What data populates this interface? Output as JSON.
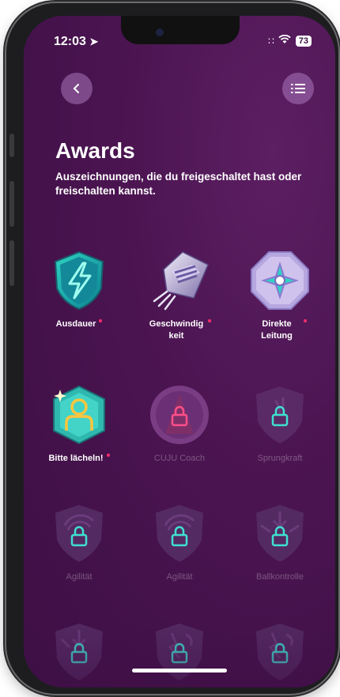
{
  "status": {
    "time": "12:03",
    "battery": "73"
  },
  "nav": {
    "back_icon": "chevron-left-icon",
    "menu_icon": "list-icon"
  },
  "header": {
    "title": "Awards",
    "subtitle": "Auszeichnungen, die du freigeschaltet hast oder freischalten kannst."
  },
  "colors": {
    "background": "#4a1450",
    "accent_dot": "#ff2d6e",
    "teal": "#3fe0d0"
  },
  "awards": [
    {
      "label": "Ausdauer",
      "unlocked": true,
      "new": true,
      "icon": "lightning-shield-icon"
    },
    {
      "label": "Geschwindig keit",
      "unlocked": true,
      "new": true,
      "icon": "speed-crystal-icon"
    },
    {
      "label": "Direkte Leitung",
      "unlocked": true,
      "new": true,
      "icon": "compass-octagon-icon"
    },
    {
      "label": "Bitte lächeln!",
      "unlocked": true,
      "new": true,
      "icon": "person-hexagon-icon"
    },
    {
      "label": "CUJU Coach",
      "unlocked": false,
      "new": false,
      "icon": "cone-lock-icon"
    },
    {
      "label": "Sprungkraft",
      "unlocked": false,
      "new": false,
      "icon": "shield-lock-icon"
    },
    {
      "label": "Agilität",
      "unlocked": false,
      "new": false,
      "icon": "shield-lock-icon"
    },
    {
      "label": "Agilität",
      "unlocked": false,
      "new": false,
      "icon": "shield-lock-icon"
    },
    {
      "label": "Ballkontrolle",
      "unlocked": false,
      "new": false,
      "icon": "shield-lock-icon"
    },
    {
      "label": "",
      "unlocked": false,
      "new": false,
      "icon": "shield-lock-icon"
    },
    {
      "label": "",
      "unlocked": false,
      "new": false,
      "icon": "shield-lock-icon"
    },
    {
      "label": "",
      "unlocked": false,
      "new": false,
      "icon": "shield-lock-icon"
    }
  ]
}
